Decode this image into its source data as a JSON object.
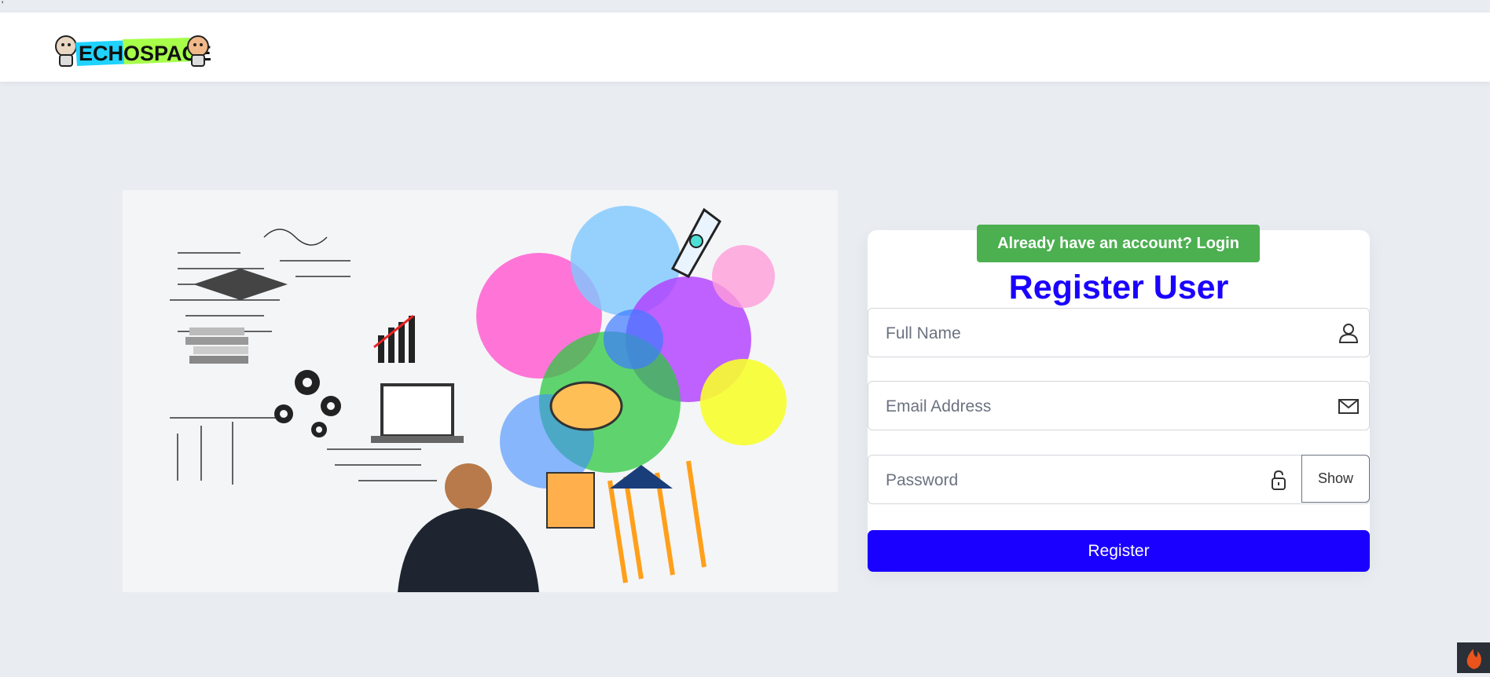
{
  "page": {
    "corner_mark": "'"
  },
  "navbar": {
    "logo_text": "ECHOSPACE"
  },
  "register": {
    "login_link": "Already have an account? Login",
    "title": "Register User",
    "full_name": {
      "placeholder": "Full Name",
      "value": "",
      "icon": "user-icon"
    },
    "email": {
      "placeholder": "Email Address",
      "value": "",
      "icon": "mail-icon"
    },
    "password": {
      "placeholder": "Password",
      "value": "",
      "icon": "lock-icon",
      "toggle_label": "Show"
    },
    "submit_label": "Register"
  },
  "colors": {
    "accent": "#1a00ff",
    "login_button": "#4caf50",
    "background": "#e9edf2"
  }
}
